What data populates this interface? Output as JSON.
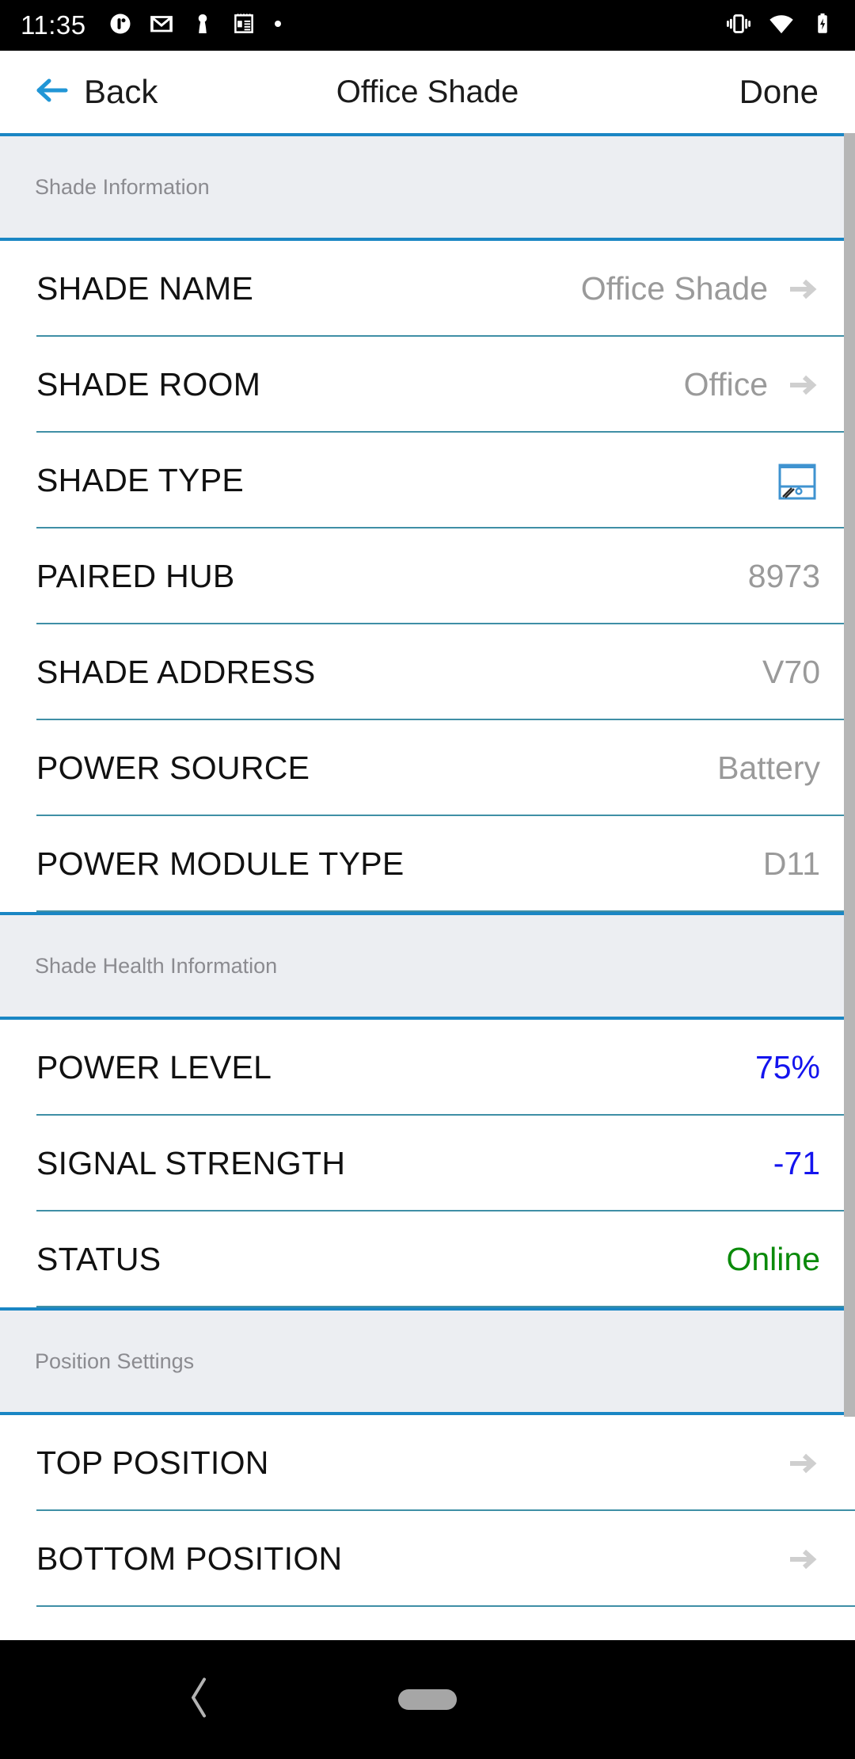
{
  "status_bar": {
    "time": "11:35",
    "left_icons": [
      "clock-app-icon",
      "gmail-icon",
      "chess-pawn-icon",
      "calendar-icon",
      "dot-icon"
    ],
    "right_icons": [
      "vibrate-icon",
      "wifi-icon",
      "battery-charging-icon"
    ]
  },
  "navbar": {
    "back_label": "Back",
    "title": "Office Shade",
    "done_label": "Done",
    "back_icon": "arrow-left-icon",
    "accent_color": "#2196d6"
  },
  "sections": [
    {
      "header": "Shade Information",
      "rows": [
        {
          "label": "SHADE NAME",
          "value": "Office Shade",
          "value_color": "#9a9a9a",
          "accessory": "arrow-right-icon"
        },
        {
          "label": "SHADE ROOM",
          "value": "Office",
          "value_color": "#9a9a9a",
          "accessory": "arrow-right-icon"
        },
        {
          "label": "SHADE TYPE",
          "value": "",
          "value_color": "#9a9a9a",
          "accessory": "roller-shade-icon"
        },
        {
          "label": "PAIRED HUB",
          "value": "8973",
          "value_color": "#9a9a9a",
          "accessory": "none"
        },
        {
          "label": "SHADE ADDRESS",
          "value": "V70",
          "value_color": "#9a9a9a",
          "accessory": "none"
        },
        {
          "label": "POWER SOURCE",
          "value": "Battery",
          "value_color": "#9a9a9a",
          "accessory": "none"
        },
        {
          "label": "POWER MODULE TYPE",
          "value": "D11",
          "value_color": "#9a9a9a",
          "accessory": "none"
        }
      ]
    },
    {
      "header": "Shade Health Information",
      "rows": [
        {
          "label": "POWER LEVEL",
          "value": "75%",
          "value_color": "#1414ee",
          "accessory": "none"
        },
        {
          "label": "SIGNAL STRENGTH",
          "value": "-71",
          "value_color": "#1414ee",
          "accessory": "none"
        },
        {
          "label": "STATUS",
          "value": "Online",
          "value_color": "#0a8a0a",
          "accessory": "none"
        }
      ]
    },
    {
      "header": "Position Settings",
      "rows": [
        {
          "label": "TOP POSITION",
          "value": "",
          "value_color": "#9a9a9a",
          "accessory": "arrow-right-icon"
        },
        {
          "label": "BOTTOM POSITION",
          "value": "",
          "value_color": "#9a9a9a",
          "accessory": "arrow-right-icon"
        }
      ]
    }
  ],
  "bottom_nav": {
    "back_icon": "chevron-left-icon",
    "home_indicator": "home-pill-indicator"
  },
  "colors": {
    "divider": "#3f8fa6",
    "section_border": "#1a86c4",
    "section_bg": "#eceef2",
    "accent": "#2196d6",
    "value_gray": "#9a9a9a",
    "value_blue": "#1414ee",
    "value_green": "#0a8a0a"
  }
}
